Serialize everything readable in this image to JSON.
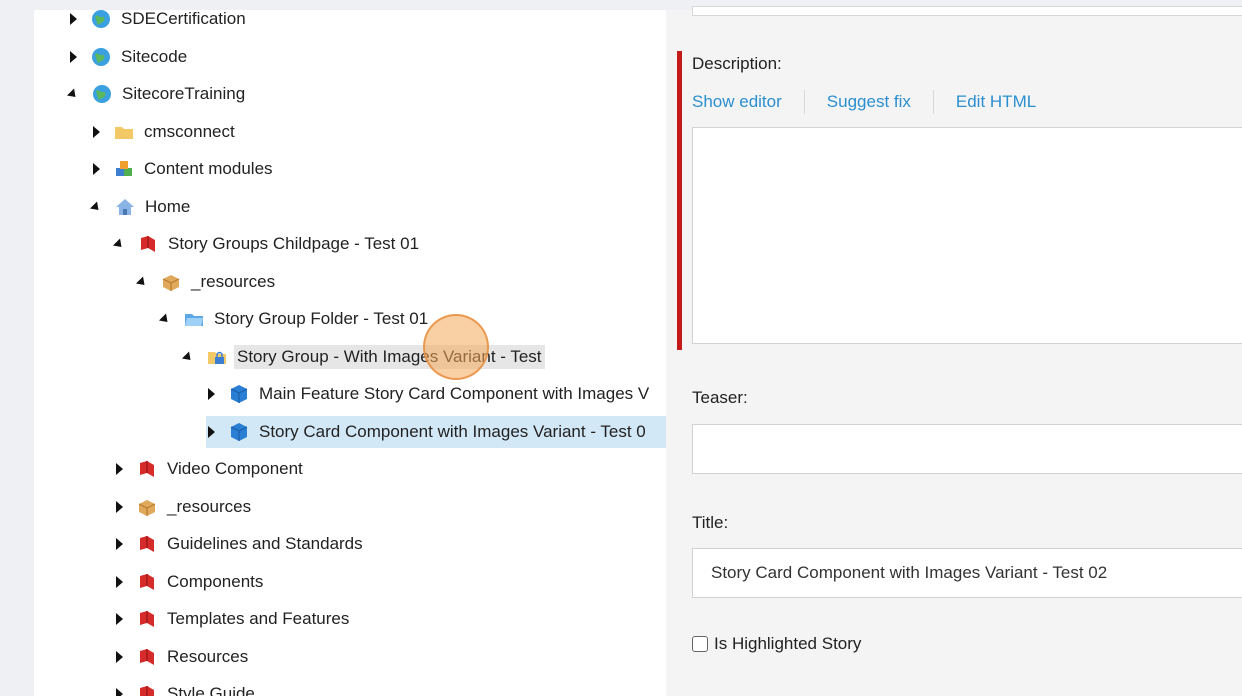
{
  "tree": {
    "items": [
      {
        "label": "SDECertification",
        "icon": "globe-icon",
        "state": "closed"
      },
      {
        "label": "Sitecode",
        "icon": "globe-icon",
        "state": "closed"
      },
      {
        "label": "SitecoreTraining",
        "icon": "globe-icon",
        "state": "open"
      },
      {
        "label": "cmsconnect",
        "icon": "folder-icon",
        "state": "closed"
      },
      {
        "label": "Content modules",
        "icon": "modules-icon",
        "state": "closed"
      },
      {
        "label": "Home",
        "icon": "home-icon",
        "state": "open"
      },
      {
        "label": "Story Groups Childpage - Test 01",
        "icon": "bookmark-icon",
        "state": "open"
      },
      {
        "label": "_resources",
        "icon": "box-icon",
        "state": "open"
      },
      {
        "label": "Story Group Folder - Test 01",
        "icon": "folder-blue-icon",
        "state": "open"
      },
      {
        "label": "Story Group - With Images Variant - Test",
        "icon": "folder-lock-icon",
        "state": "open"
      },
      {
        "label": "Main Feature Story Card Component with Images V",
        "icon": "cube-icon",
        "state": "closed"
      },
      {
        "label": "Story Card Component with Images Variant - Test 0",
        "icon": "cube-icon",
        "state": "closed"
      },
      {
        "label": "Video Component",
        "icon": "bookmark-icon",
        "state": "closed"
      },
      {
        "label": "_resources",
        "icon": "box-icon",
        "state": "closed"
      },
      {
        "label": "Guidelines and Standards",
        "icon": "bookmark-icon",
        "state": "closed"
      },
      {
        "label": "Components",
        "icon": "bookmark-icon",
        "state": "closed"
      },
      {
        "label": "Templates and Features",
        "icon": "bookmark-icon",
        "state": "closed"
      },
      {
        "label": "Resources",
        "icon": "bookmark-icon",
        "state": "closed"
      },
      {
        "label": "Style Guide",
        "icon": "bookmark-icon",
        "state": "closed"
      }
    ]
  },
  "editor": {
    "description_label": "Description:",
    "links": {
      "show_editor": "Show editor",
      "suggest_fix": "Suggest fix",
      "edit_html": "Edit HTML"
    },
    "teaser_label": "Teaser:",
    "teaser_value": "",
    "title_label": "Title:",
    "title_value": "Story Card Component with Images Variant - Test 02",
    "highlight_label": "Is Highlighted Story"
  },
  "colors": {
    "accent_red": "#c41a1a",
    "link_blue": "#2b8fd0",
    "selected_bg": "#d2e8f6"
  }
}
